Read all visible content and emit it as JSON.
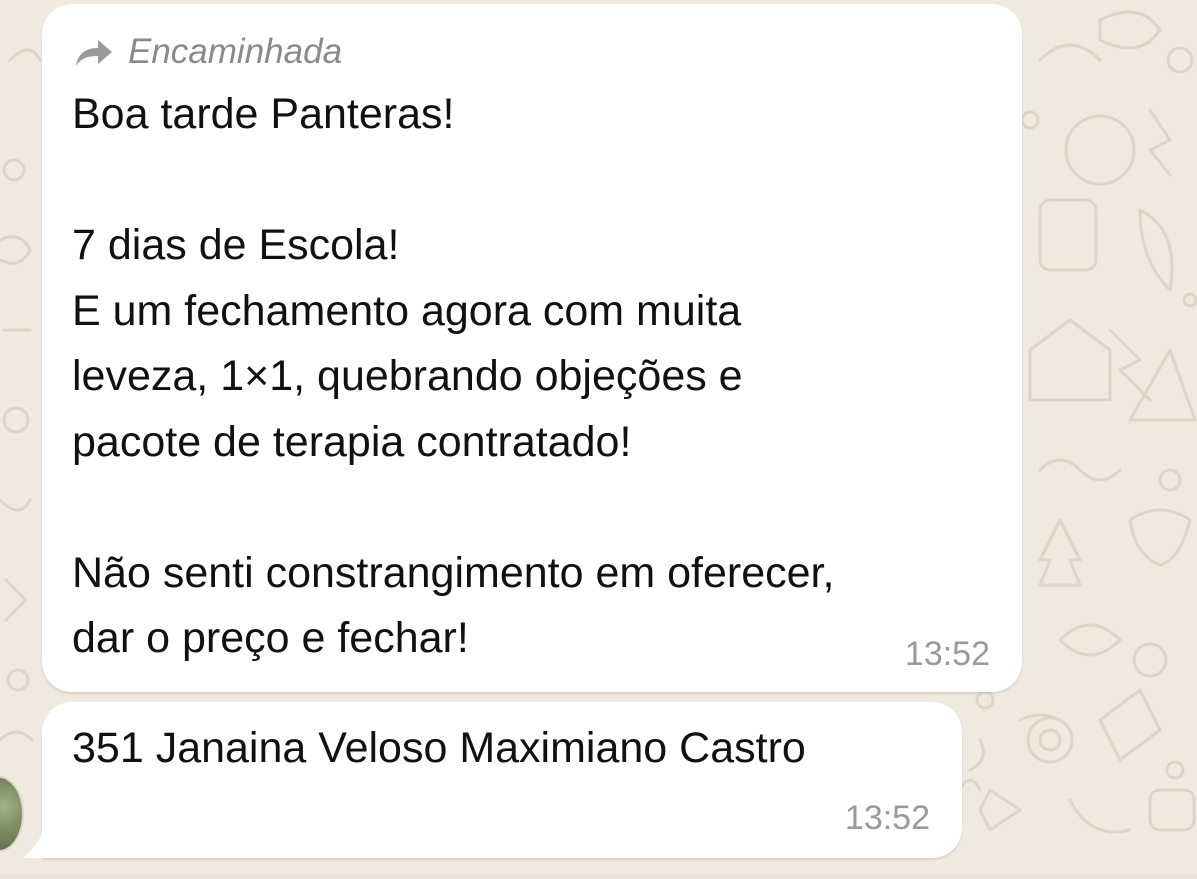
{
  "chat": {
    "background_color": "#efe9df",
    "bubble_color": "#ffffff",
    "messages": [
      {
        "forwarded_label": "Encaminhada",
        "forwarded_icon": "forward-arrow-icon",
        "text": "Boa tarde Panteras!\n\n7 dias de Escola!\nE um fechamento agora com muita\nleveza, 1×1, quebrando objeções e\npacote de terapia contratado!\n\nNão senti constrangimento em oferecer,\ndar o preço e fechar!",
        "time": "13:52"
      },
      {
        "text": "351 Janaina Veloso Maximiano Castro",
        "time": "13:52"
      }
    ]
  }
}
